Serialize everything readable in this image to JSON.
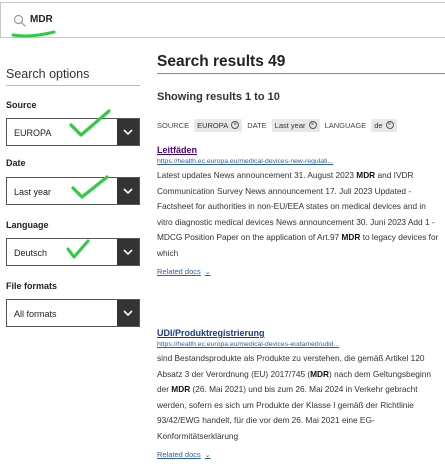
{
  "search": {
    "value": "MDR"
  },
  "sidebar": {
    "title": "Search options",
    "options": [
      {
        "label": "Source",
        "value": "EUROPA"
      },
      {
        "label": "Date",
        "value": "Last year"
      },
      {
        "label": "Language",
        "value": "Deutsch"
      },
      {
        "label": "File formats",
        "value": "All formats"
      }
    ]
  },
  "results": {
    "title": "Search results 49",
    "showing": "Showing results 1 to 10",
    "filters": [
      {
        "label": "SOURCE",
        "chip": "EUROPA"
      },
      {
        "label": "DATE",
        "chip": "Last year"
      },
      {
        "label": "LANGUAGE",
        "chip": "de"
      }
    ],
    "items": [
      {
        "title": "Leitfäden",
        "url": "https://health.ec.europa.eu/medical-devices-new-regulati...",
        "snippet": [
          "Latest updates News announcement 31. August 2023 ",
          {
            "b": "MDR"
          },
          " and IVDR Communication Survey News announcement 17. Juli 2023 Updated - Factsheet for authorities in non-EU/EEA states on medical devices and in vitro diagnostic medical devices News announcement 30. Juni 2023 Add 1 - MDCG Position Paper on the application of Art.97 ",
          {
            "b": "MDR"
          },
          " to legacy devices for which"
        ],
        "related": "Related docs"
      },
      {
        "title": "UDI/Produktregistrierung",
        "url": "https://health.ec.europa.eu/medical-devices-eudamed/udid...",
        "snippet": [
          "sind Bestandsprodukte als Produkte zu verstehen, die gemäß Artikel 120 Absatz 3 der Verordnung (EU) 2017/745 (",
          {
            "b": "MDR"
          },
          ") nach dem Geltungsbeginn der ",
          {
            "b": "MDR"
          },
          " (26. Mai 2021) und bis zum 26. Mai 2024 in Verkehr gebracht werden, sofern es sich um Produkte der Klasse I gemäß der Richtlinie 93/42/EWG handelt, für die vor dem 26. Mai 2021 eine EG-Konformitätserklärung"
        ],
        "related": "Related docs"
      }
    ]
  },
  "colors": {
    "annotation": "#2ecc40",
    "dropdown_arrow_bg": "#333333",
    "link": "#2a5fa8"
  }
}
